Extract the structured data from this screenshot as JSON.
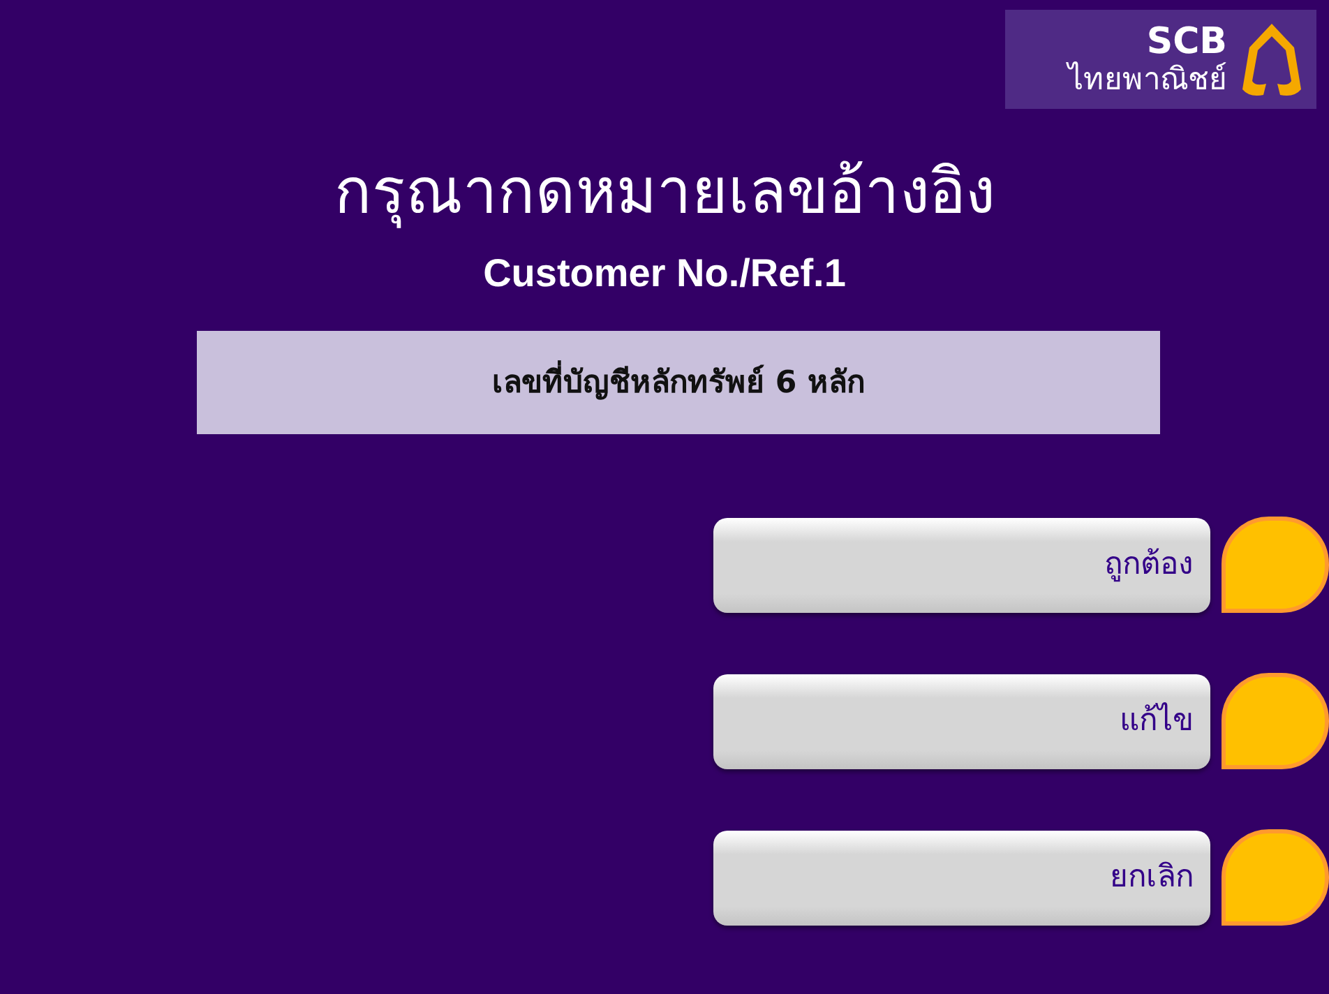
{
  "logo": {
    "brand": "SCB",
    "name": "ไทยพาณิชย์"
  },
  "title": "กรุณากดหมายเลขอ้างอิง",
  "subtitle": "Customer No./Ref.1",
  "input_field": {
    "value": "เลขที่บัญชีหลักทรัพย์ 6 หลัก"
  },
  "buttons": [
    {
      "label": "ถูกต้อง"
    },
    {
      "label": "แก้ไข"
    },
    {
      "label": "ยกเลิก"
    }
  ]
}
